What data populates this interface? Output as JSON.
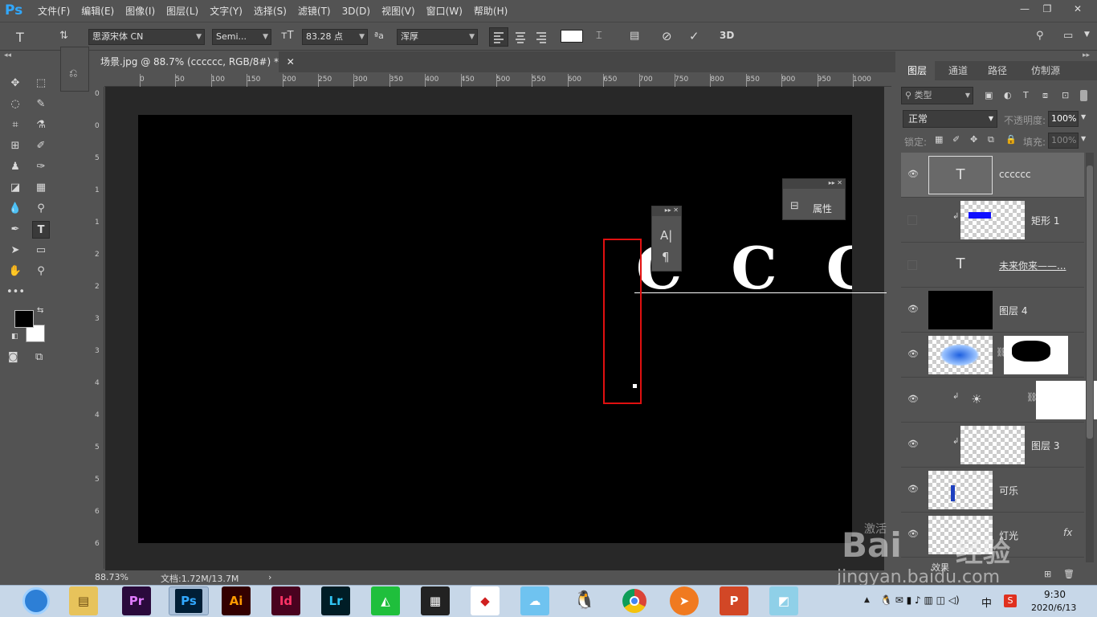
{
  "app": {
    "logo": "Ps",
    "menu": [
      "文件(F)",
      "编辑(E)",
      "图像(I)",
      "图层(L)",
      "文字(Y)",
      "选择(S)",
      "滤镜(T)",
      "3D(D)",
      "视图(V)",
      "窗口(W)",
      "帮助(H)"
    ]
  },
  "options": {
    "font_family": "思源宋体 CN",
    "font_style": "Semi...",
    "font_size": "83.28 点",
    "anti_alias": "浑厚",
    "aa_label": "ªa"
  },
  "document": {
    "tab_title": "场景.jpg @ 88.7% (cccccc, RGB/8#) *",
    "ruler_top": [
      "0",
      "50",
      "100",
      "150",
      "200",
      "250",
      "300",
      "350",
      "400",
      "450",
      "500",
      "550",
      "600",
      "650",
      "700",
      "750",
      "800",
      "850",
      "900",
      "950",
      "1000"
    ],
    "ruler_left": [
      "0",
      "0",
      "5",
      "1",
      "1",
      "2",
      "2",
      "3",
      "3",
      "4",
      "4",
      "5",
      "5",
      "6",
      "6"
    ],
    "canvas_text": "C C C C"
  },
  "status": {
    "zoom": "88.73%",
    "doc": "文档:1.72M/13.7M"
  },
  "floating": {
    "char_icon": "A|",
    "para_icon": "¶",
    "properties_label": "属性"
  },
  "layers_panel": {
    "tabs": [
      "图层",
      "通道",
      "路径",
      "仿制源"
    ],
    "filter_kind": "类型",
    "blend_mode": "正常",
    "opacity_label": "不透明度:",
    "opacity_value": "100%",
    "lock_label": "锁定:",
    "fill_label": "填充:",
    "fill_value": "100%",
    "layers": [
      {
        "name": "cccccc",
        "type": "text",
        "visible": true,
        "selected": true
      },
      {
        "name": "矩形 1",
        "type": "shape",
        "visible": false,
        "clipped": true
      },
      {
        "name": "未来你来——...",
        "type": "text",
        "visible": false
      },
      {
        "name": "图层 4",
        "type": "black",
        "visible": true
      },
      {
        "name": "",
        "type": "masked",
        "visible": true
      },
      {
        "name": "",
        "type": "adjustment",
        "visible": true,
        "clipped": true
      },
      {
        "name": "图层 3",
        "type": "pixel",
        "visible": true,
        "clipped": true
      },
      {
        "name": "可乐",
        "type": "smart",
        "visible": true
      },
      {
        "name": "灯光",
        "type": "smart",
        "visible": true,
        "fx": "fx"
      }
    ],
    "effects_label": "效果"
  },
  "taskbar": {
    "apps": [
      "Pr",
      "Ps",
      "Ai",
      "Id",
      "Lr"
    ],
    "time": "9:30",
    "date": "2020/6/13",
    "ime": "中"
  },
  "watermark": {
    "brand": "Bai",
    "brand2": "经验",
    "url": "jingyan.baidu.com",
    "activate": "激活"
  }
}
